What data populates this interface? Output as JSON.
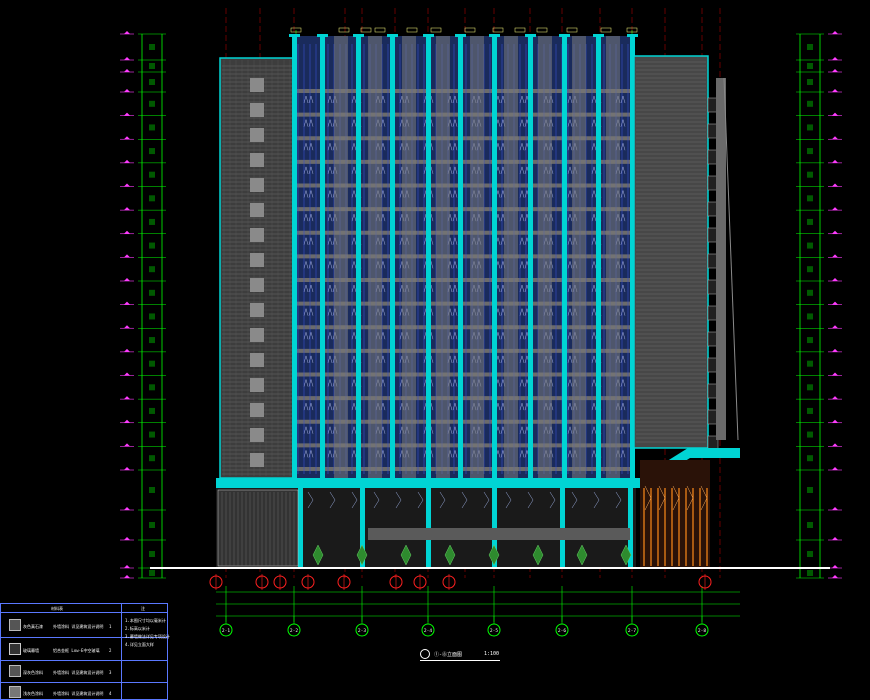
{
  "drawing": {
    "title": "①-⑧立面图",
    "scale": "1:100",
    "axis_bubbles": [
      "2-1",
      "2-2",
      "2-3",
      "2-4",
      "2-5",
      "2-6",
      "2-7",
      "2-8"
    ],
    "floor_count": 16,
    "colors": {
      "background": "#000000",
      "dimension": "#00ff00",
      "curtain_frame": "#00d4d4",
      "axis_line": "#c80000",
      "wall": "#6b6b6b",
      "glass": "#1a2b5c",
      "mullion": "#3a4fd0",
      "level_marker": "#ff3cff",
      "grid_bubble": "#ff2020",
      "orange_fin": "#ff8c1a"
    }
  },
  "legend": {
    "header": "材料表",
    "rows": [
      {
        "name": "灰色真石漆",
        "desc": "外墙涂料 详见建筑设计说明",
        "code": "1"
      },
      {
        "name": "玻璃幕墙",
        "desc": "铝合金框 Low-E中空玻璃",
        "code": "2"
      },
      {
        "name": "深灰色涂料",
        "desc": "外墙涂料 详见建筑设计说明",
        "code": "3"
      },
      {
        "name": "浅灰色涂料",
        "desc": "外墙涂料 详见建筑设计说明",
        "code": "4"
      }
    ],
    "notes_header": "注",
    "notes": [
      "1.本图尺寸均以毫米计",
      "2.标高以米计",
      "3.幕墙做法详见专项设计",
      "4.详见立面大样"
    ]
  }
}
